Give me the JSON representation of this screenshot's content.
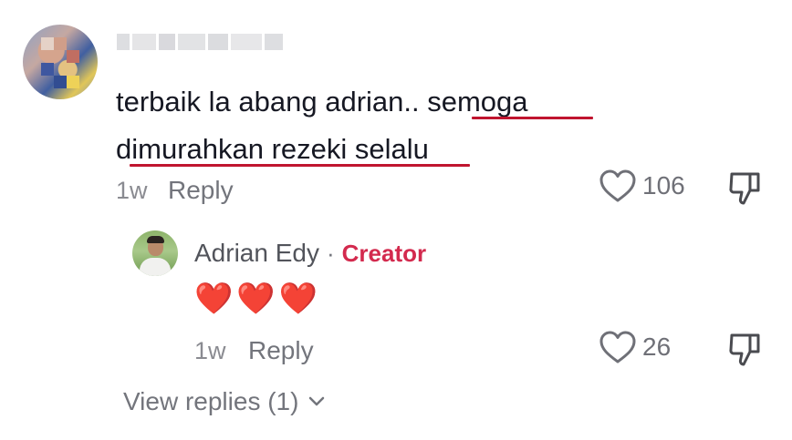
{
  "comment": {
    "username_visible": "",
    "text_line1": "terbaik la abang adrian.. semoga",
    "text_line2": "dimurahkan rezeki selalu",
    "time": "1w",
    "reply_label": "Reply",
    "like_count": "106",
    "like_icon": "heart-outline-icon",
    "dislike_icon": "thumbs-down-icon"
  },
  "reply": {
    "author": "Adrian Edy",
    "separator": "·",
    "badge": "Creator",
    "text": "❤️❤️❤️",
    "time": "1w",
    "reply_label": "Reply",
    "like_count": "26"
  },
  "view_replies": {
    "label": "View replies (1)",
    "chevron": "⌄"
  },
  "colors": {
    "underline": "#c0152f",
    "creator": "#d32a4e",
    "muted": "#73757c"
  }
}
